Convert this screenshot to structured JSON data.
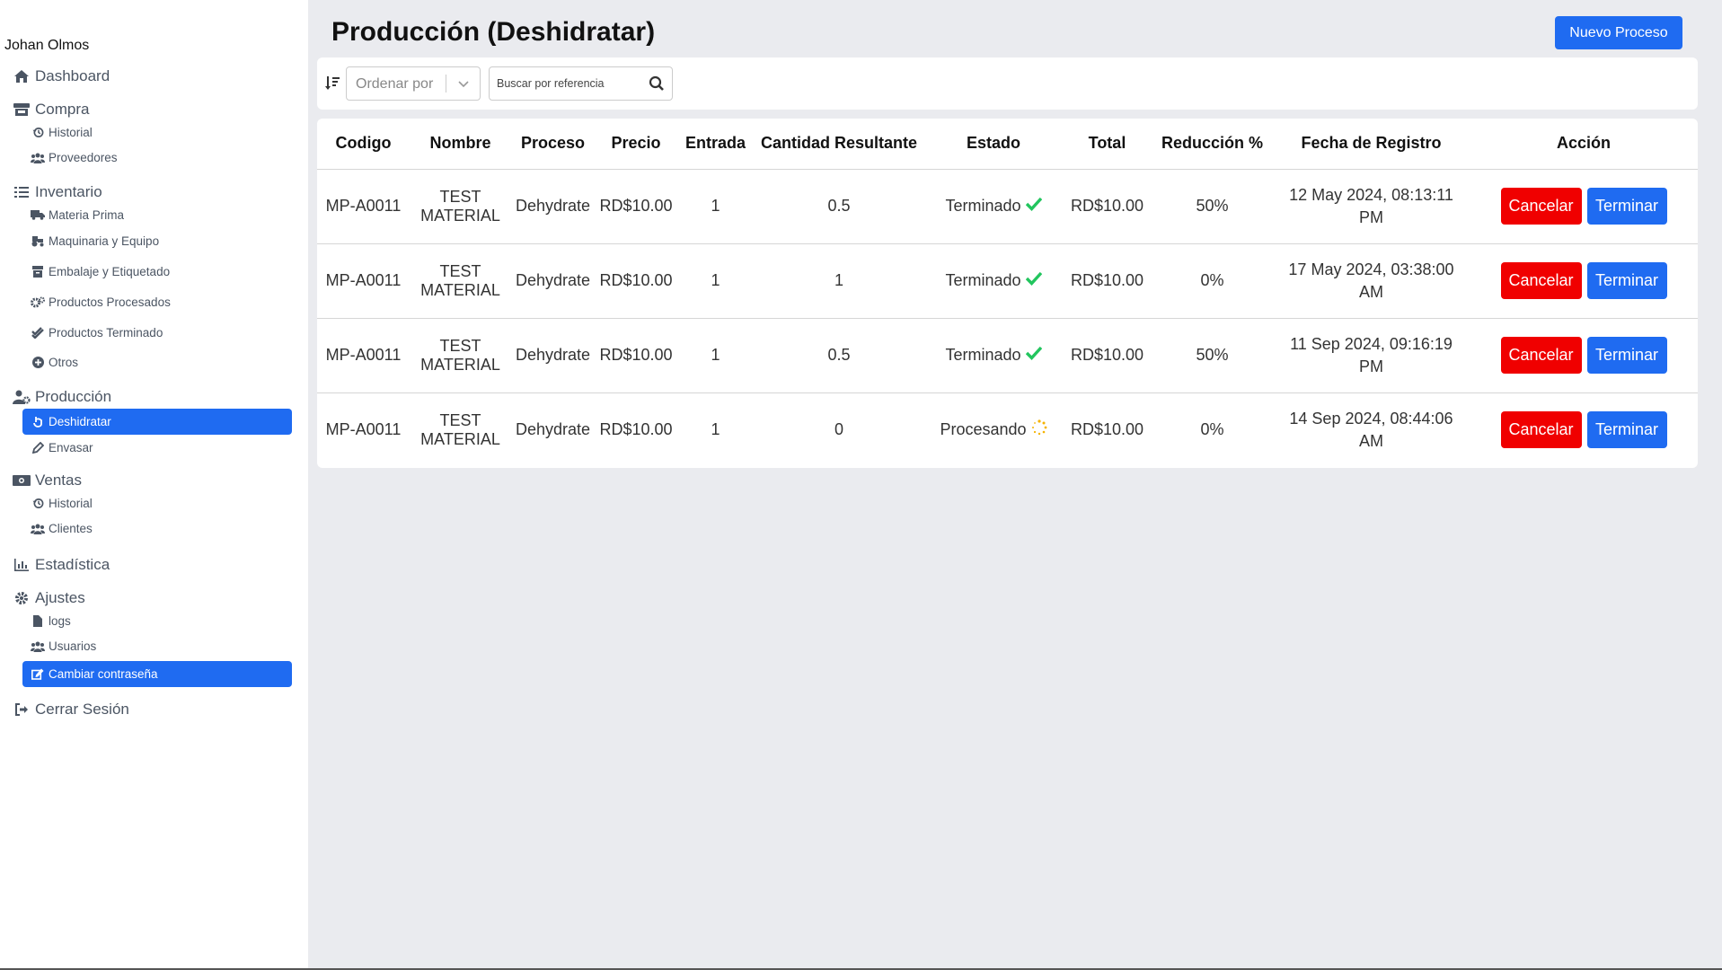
{
  "user": {
    "name": "Johan Olmos"
  },
  "sidebar": {
    "sections": [
      {
        "label": "Dashboard",
        "icon": "home-icon",
        "items": []
      },
      {
        "label": "Compra",
        "icon": "store-icon",
        "items": [
          {
            "label": "Historial",
            "icon": "history-icon"
          },
          {
            "label": "Proveedores",
            "icon": "users-icon"
          }
        ]
      },
      {
        "label": "Inventario",
        "icon": "list-icon",
        "items": [
          {
            "label": "Materia Prima",
            "icon": "truck-icon"
          },
          {
            "label": "Maquinaria y Equipo",
            "icon": "tractor-icon"
          },
          {
            "label": "Embalaje y Etiquetado",
            "icon": "box-icon"
          },
          {
            "label": "Productos Procesados",
            "icon": "gears-icon"
          },
          {
            "label": "Productos Terminado",
            "icon": "check-double-icon"
          },
          {
            "label": "Otros",
            "icon": "plus-circle-icon"
          }
        ]
      },
      {
        "label": "Producción",
        "icon": "user-gear-icon",
        "items": [
          {
            "label": "Deshidratar",
            "icon": "hand-icon",
            "active": true
          },
          {
            "label": "Envasar",
            "icon": "pen-icon"
          }
        ]
      },
      {
        "label": "Ventas",
        "icon": "money-icon",
        "items": [
          {
            "label": "Historial",
            "icon": "history-icon"
          },
          {
            "label": "Clientes",
            "icon": "users-icon"
          }
        ]
      },
      {
        "label": "Estadística",
        "icon": "bar-chart-icon",
        "items": []
      },
      {
        "label": "Ajustes",
        "icon": "gear-icon",
        "items": [
          {
            "label": "logs",
            "icon": "file-icon"
          },
          {
            "label": "Usuarios",
            "icon": "users-icon"
          },
          {
            "label": "Cambiar contraseña",
            "icon": "edit-icon",
            "active": true
          }
        ]
      },
      {
        "label": "Cerrar Sesión",
        "icon": "sign-out-icon",
        "items": []
      }
    ]
  },
  "page": {
    "title": "Producción (Deshidratar)",
    "new_button": "Nuevo Proceso"
  },
  "toolbar": {
    "sort_placeholder": "Ordenar por",
    "search_placeholder": "Buscar por referencia"
  },
  "table": {
    "headers": [
      "Codigo",
      "Nombre",
      "Proceso",
      "Precio",
      "Entrada",
      "Cantidad Resultante",
      "Estado",
      "Total",
      "Reducción %",
      "Fecha de Registro",
      "Acción"
    ],
    "rows": [
      {
        "codigo": "MP-A0011",
        "nombre": "TEST MATERIAL",
        "proceso": "Dehydrate",
        "precio": "RD$10.00",
        "entrada": "1",
        "cantidad": "0.5",
        "estado": "Terminado",
        "estado_icon": "check-icon",
        "total": "RD$10.00",
        "reduccion": "50%",
        "fecha_l1": "12 May 2024, 08:13:11",
        "fecha_l2": "PM"
      },
      {
        "codigo": "MP-A0011",
        "nombre": "TEST MATERIAL",
        "proceso": "Dehydrate",
        "precio": "RD$10.00",
        "entrada": "1",
        "cantidad": "1",
        "estado": "Terminado",
        "estado_icon": "check-icon",
        "total": "RD$10.00",
        "reduccion": "0%",
        "fecha_l1": "17 May 2024, 03:38:00",
        "fecha_l2": "AM"
      },
      {
        "codigo": "MP-A0011",
        "nombre": "TEST MATERIAL",
        "proceso": "Dehydrate",
        "precio": "RD$10.00",
        "entrada": "1",
        "cantidad": "0.5",
        "estado": "Terminado",
        "estado_icon": "check-icon",
        "total": "RD$10.00",
        "reduccion": "50%",
        "fecha_l1": "11 Sep 2024, 09:16:19",
        "fecha_l2": "PM"
      },
      {
        "codigo": "MP-A0011",
        "nombre": "TEST MATERIAL",
        "proceso": "Dehydrate",
        "precio": "RD$10.00",
        "entrada": "1",
        "cantidad": "0",
        "estado": "Procesando",
        "estado_icon": "spinner-icon",
        "total": "RD$10.00",
        "reduccion": "0%",
        "fecha_l1": "14 Sep 2024, 08:44:06",
        "fecha_l2": "AM"
      }
    ],
    "cancel_label": "Cancelar",
    "finish_label": "Terminar"
  },
  "colors": {
    "primary": "#1f6bf1",
    "danger": "#f00000",
    "success": "#22c55e",
    "warning": "#f5b301"
  }
}
